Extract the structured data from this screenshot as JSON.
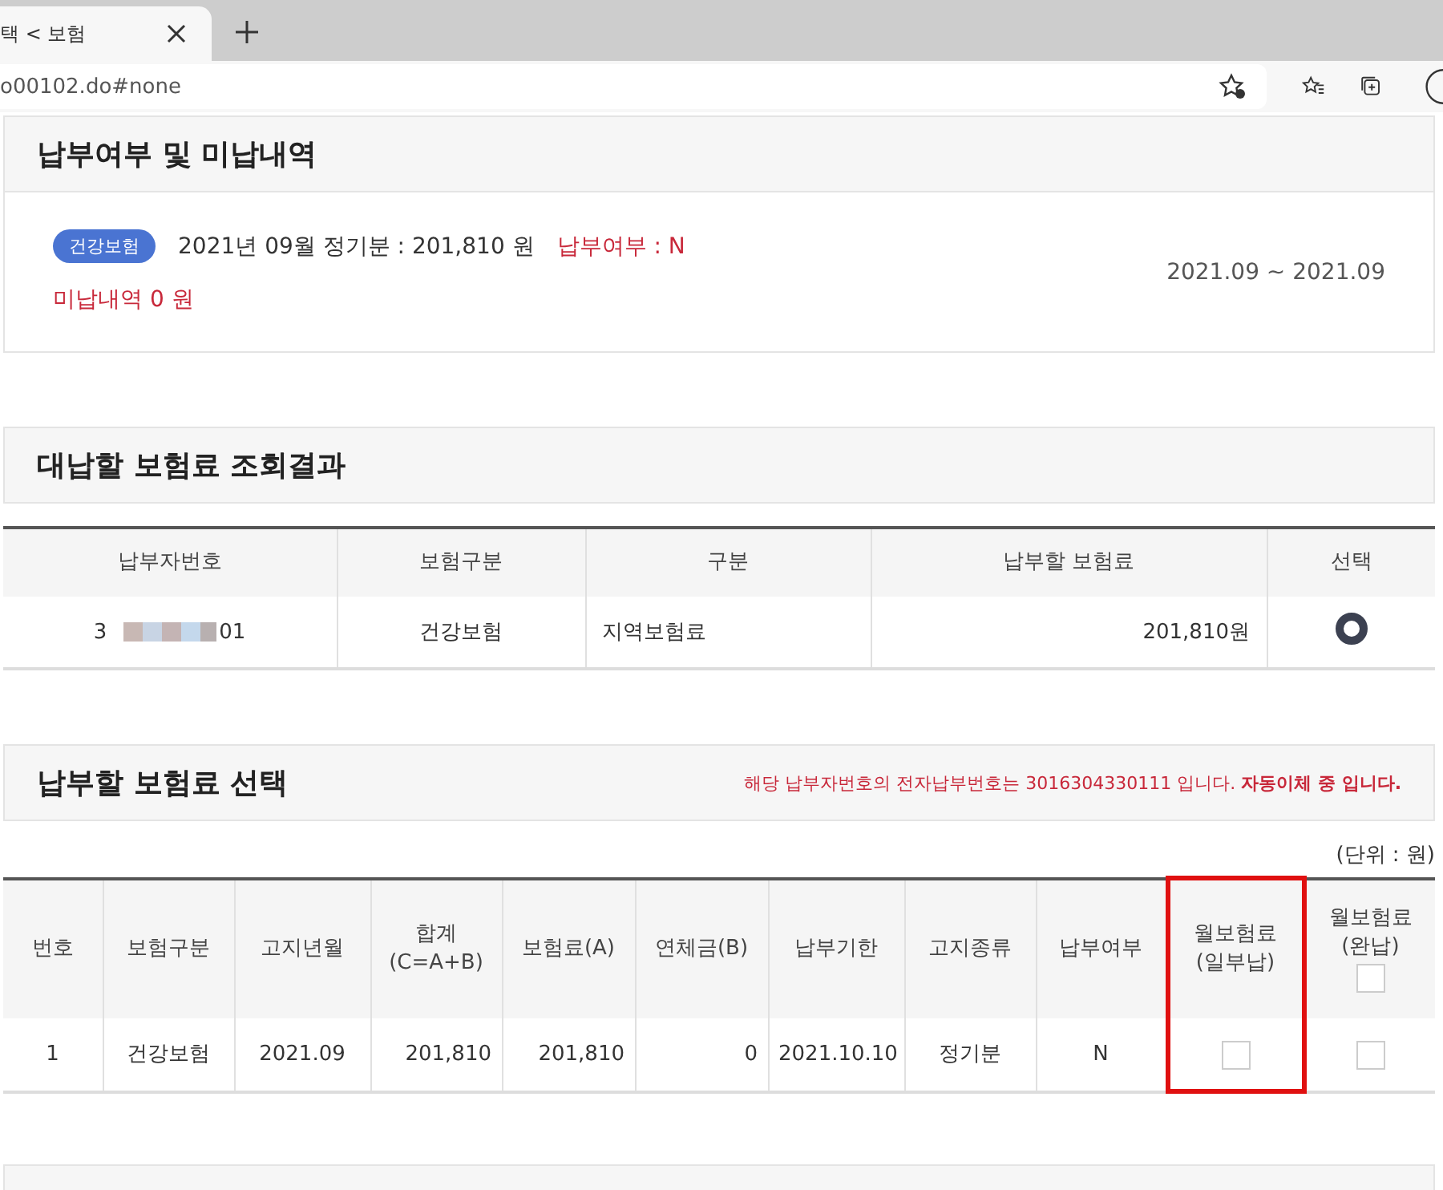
{
  "browser": {
    "tab_title": "택 < 보험",
    "address": "o00102.do#none"
  },
  "status": {
    "title": "납부여부 및 미납내역",
    "badge": "건강보험",
    "summary": "2021년 09월 정기분 : 201,810 원",
    "paid_label": "납부여부 : N",
    "unpaid": "미납내역  0 원",
    "period": "2021.09 ~ 2021.09"
  },
  "lookup": {
    "title": "대납할 보험료 조회결과",
    "columns": [
      "납부자번호",
      "보험구분",
      "구분",
      "납부할 보험료",
      "선택"
    ],
    "rows": [
      {
        "payer_prefix": "3",
        "payer_suffix": "01",
        "type": "건강보험",
        "category": "지역보험료",
        "amount": "201,810원",
        "selected": true
      }
    ]
  },
  "choice": {
    "title": "납부할 보험료 선택",
    "notice": "해당 납부자번호의 전자납부번호는 3016304330111 입니다. **자동이체 중 입니다.**",
    "unit": "(단위 : 원)",
    "columns": [
      {
        "label": "번호",
        "highlighted": false
      },
      {
        "label": "보험구분",
        "highlighted": false
      },
      {
        "label": "고지년월",
        "highlighted": false
      },
      {
        "label": "합계\n(C=A+B)",
        "highlighted": false
      },
      {
        "label": "보험료(A)",
        "highlighted": false
      },
      {
        "label": "연체금(B)",
        "highlighted": false
      },
      {
        "label": "납부기한",
        "highlighted": false
      },
      {
        "label": "고지종류",
        "highlighted": false
      },
      {
        "label": "납부여부",
        "highlighted": false
      },
      {
        "label": "월보험료\n(일부납)",
        "highlighted": true
      },
      {
        "label": "월보험료\n(완납)",
        "highlighted": false,
        "select_all": false
      }
    ],
    "rows": [
      {
        "cells": [
          "1",
          "건강보험",
          "2021.09",
          "201,810",
          "201,810",
          "0",
          "2021.10.10",
          "정기분",
          "N"
        ],
        "partial": false,
        "full": false
      }
    ]
  }
}
